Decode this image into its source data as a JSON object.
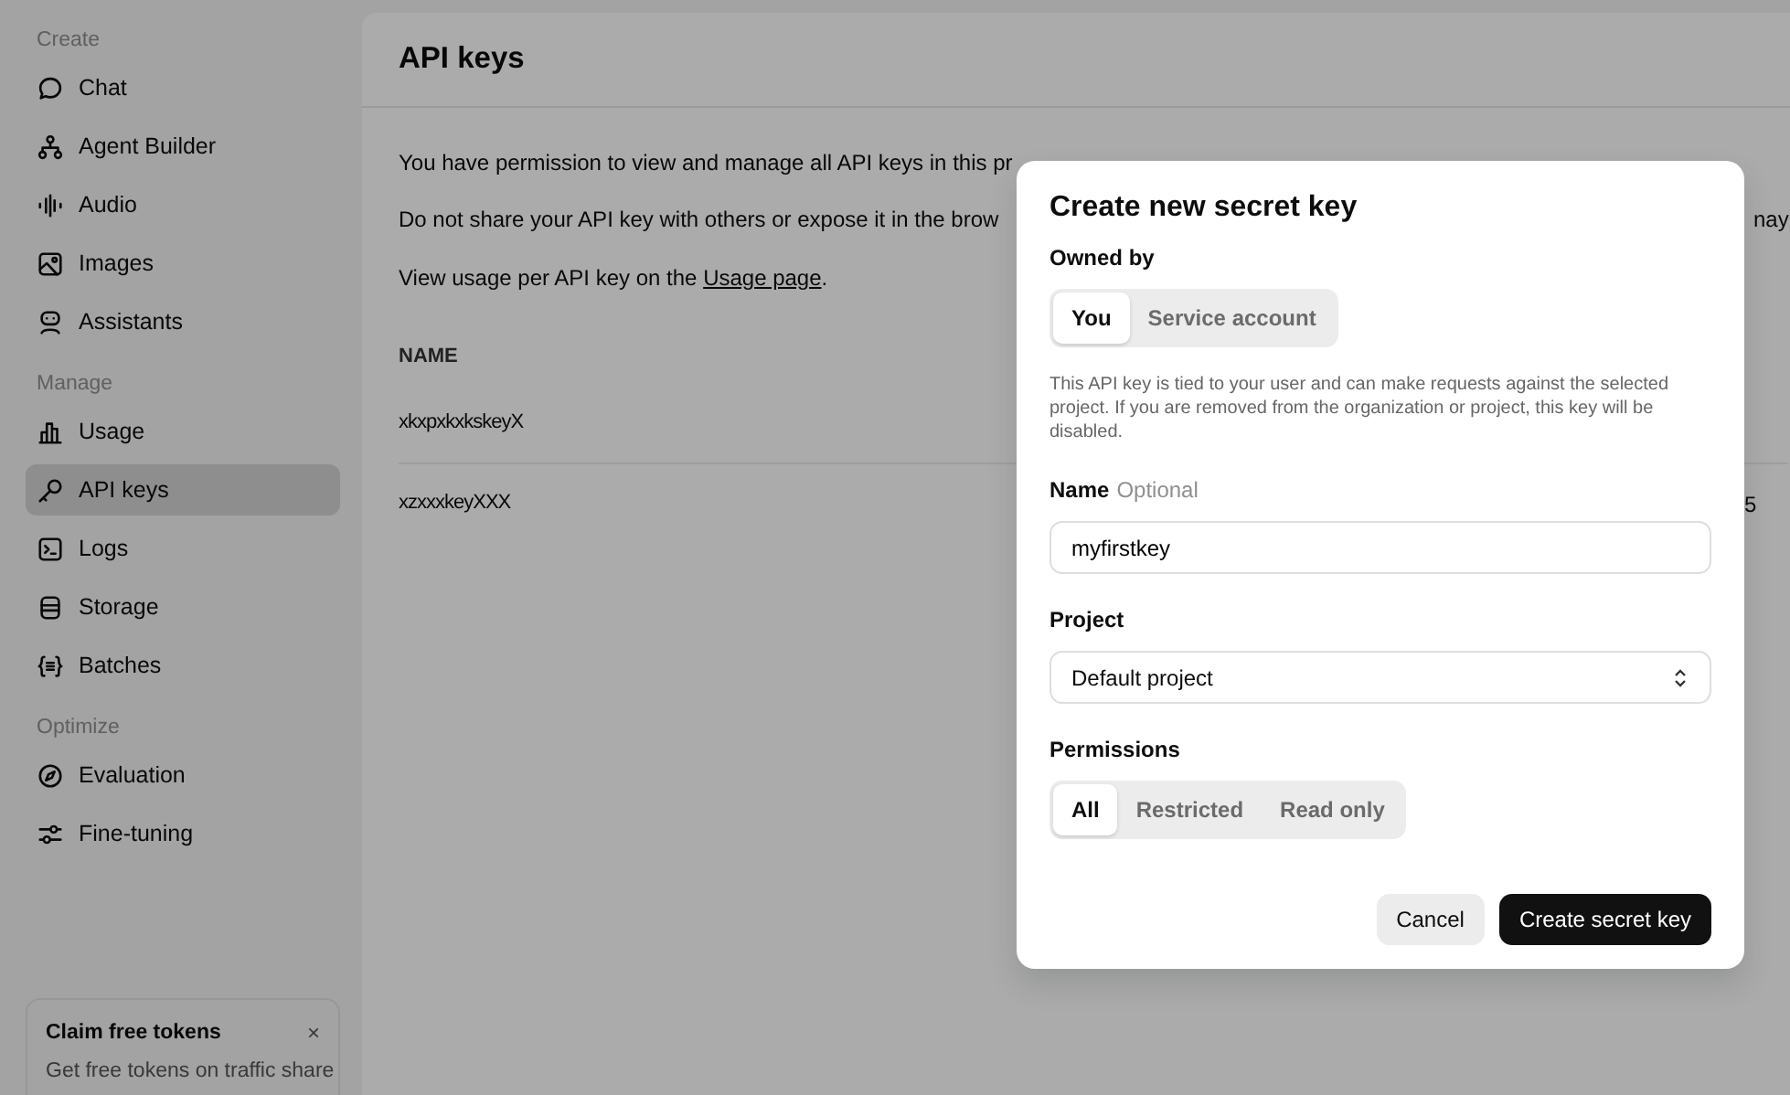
{
  "sidebar": {
    "sections": [
      {
        "heading": "Create",
        "items": [
          {
            "label": "Chat",
            "selected": false
          },
          {
            "label": "Agent Builder",
            "selected": false
          },
          {
            "label": "Audio",
            "selected": false
          },
          {
            "label": "Images",
            "selected": false
          },
          {
            "label": "Assistants",
            "selected": false
          }
        ]
      },
      {
        "heading": "Manage",
        "items": [
          {
            "label": "Usage",
            "selected": false
          },
          {
            "label": "API keys",
            "selected": true
          },
          {
            "label": "Logs",
            "selected": false
          },
          {
            "label": "Storage",
            "selected": false
          },
          {
            "label": "Batches",
            "selected": false
          }
        ]
      },
      {
        "heading": "Optimize",
        "items": [
          {
            "label": "Evaluation",
            "selected": false
          },
          {
            "label": "Fine-tuning",
            "selected": false
          }
        ]
      }
    ],
    "promo": {
      "title": "Claim free tokens",
      "close": "×",
      "text": "Get free tokens on traffic share"
    }
  },
  "page": {
    "title": "API keys",
    "lines": [
      {
        "text": "You have permission to view and manage all API keys in this pr"
      },
      {
        "text": "Do not share your API key with others or expose it in the brow",
        "tail": "nay"
      },
      {
        "text": "View usage per API key on the ",
        "link": "Usage page",
        "after": "."
      }
    ],
    "table": {
      "columns": [
        "NAME"
      ],
      "rows": [
        {
          "name": "xkxpxkxkskeyX"
        },
        {
          "name": "xzxxxkeyXXX",
          "tail": "5"
        }
      ]
    }
  },
  "dialog": {
    "title": "Create new secret key",
    "owned_label": "Owned by",
    "owners": [
      {
        "label": "You",
        "selected": true
      },
      {
        "label": "Service account",
        "selected": false
      }
    ],
    "note": "This API key is tied to your user and can make requests against the selected project. If you are removed from the organization or project, this key will be disabled.",
    "name_label": "Name",
    "name_hint": "Optional",
    "name_value": "myfirstkey",
    "project_label": "Project",
    "project_value": "Default project",
    "permissions_label": "Permissions",
    "permissions": [
      {
        "label": "All",
        "selected": true
      },
      {
        "label": "Restricted",
        "selected": false
      },
      {
        "label": "Read only",
        "selected": false
      }
    ],
    "buttons": [
      {
        "label": "Cancel",
        "kind": "secondary"
      },
      {
        "label": "Create secret key",
        "kind": "primary"
      }
    ]
  }
}
